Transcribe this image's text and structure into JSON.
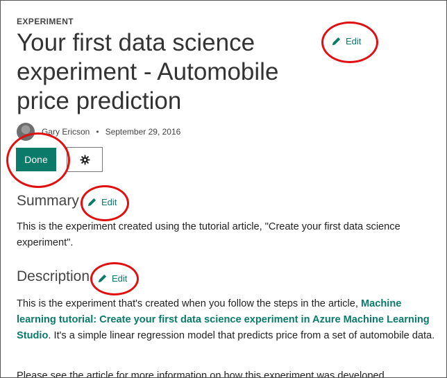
{
  "header": {
    "kicker": "EXPERIMENT",
    "title": "Your first data science experiment - Automobile price prediction",
    "edit_label": "Edit"
  },
  "meta": {
    "author": "Gary Ericson",
    "separator": "•",
    "date": "September 29, 2016"
  },
  "actions": {
    "done_label": "Done",
    "gear_icon": "gear-icon"
  },
  "summary": {
    "heading": "Summary",
    "edit_label": "Edit",
    "text": "This is the experiment created using the tutorial article, \"Create your first data science experiment\"."
  },
  "description": {
    "heading": "Description",
    "edit_label": "Edit",
    "text_before_link": "This is the experiment that's created when you follow the steps in the article, ",
    "link_text": "Machine learning tutorial: Create your first data science experiment in Azure Machine Learning Studio",
    "text_after_link": ". It's a simple linear regression model that predicts price from a set of automobile data.",
    "next_paragraph": "Please see the article for more information on how this experiment was developed."
  },
  "colors": {
    "accent": "#0b7a68",
    "annotation": "#e01010"
  }
}
